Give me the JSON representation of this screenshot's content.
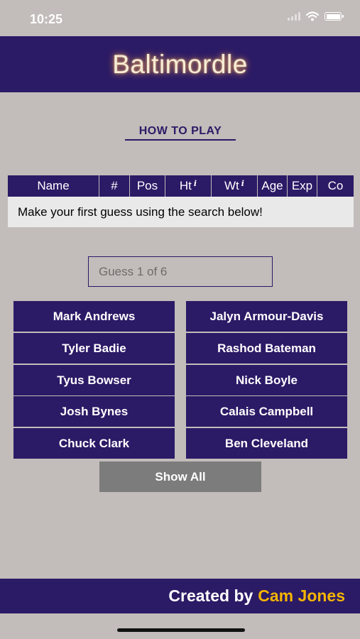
{
  "status_bar": {
    "time": "10:25"
  },
  "header": {
    "title": "Baltimordle"
  },
  "how_to_play": "HOW TO PLAY",
  "table": {
    "columns": [
      {
        "label": "Name",
        "info": ""
      },
      {
        "label": "#",
        "info": ""
      },
      {
        "label": "Pos",
        "info": ""
      },
      {
        "label": "Ht",
        "info": "i"
      },
      {
        "label": "Wt",
        "info": "i"
      },
      {
        "label": "Age",
        "info": ""
      },
      {
        "label": "Exp",
        "info": ""
      },
      {
        "label": "Co",
        "info": ""
      }
    ],
    "empty_message": "Make your first guess using the search below!"
  },
  "search": {
    "placeholder": "Guess 1 of 6",
    "value": ""
  },
  "players": [
    "Mark Andrews",
    "Jalyn Armour-Davis",
    "Tyler Badie",
    "Rashod Bateman",
    "Tyus Bowser",
    "Nick Boyle",
    "Josh Bynes",
    "Calais Campbell",
    "Chuck Clark",
    "Ben Cleveland"
  ],
  "show_all": "Show All",
  "footer": {
    "prefix": "Created by",
    "author": "Cam Jones"
  },
  "colors": {
    "primary": "#2b1a66",
    "background": "#c2bcba",
    "accent": "#f4b400",
    "show_all_bg": "#7c7c7c"
  },
  "icons": [
    "wifi-icon",
    "signal-icon",
    "battery-icon",
    "info-icon"
  ]
}
